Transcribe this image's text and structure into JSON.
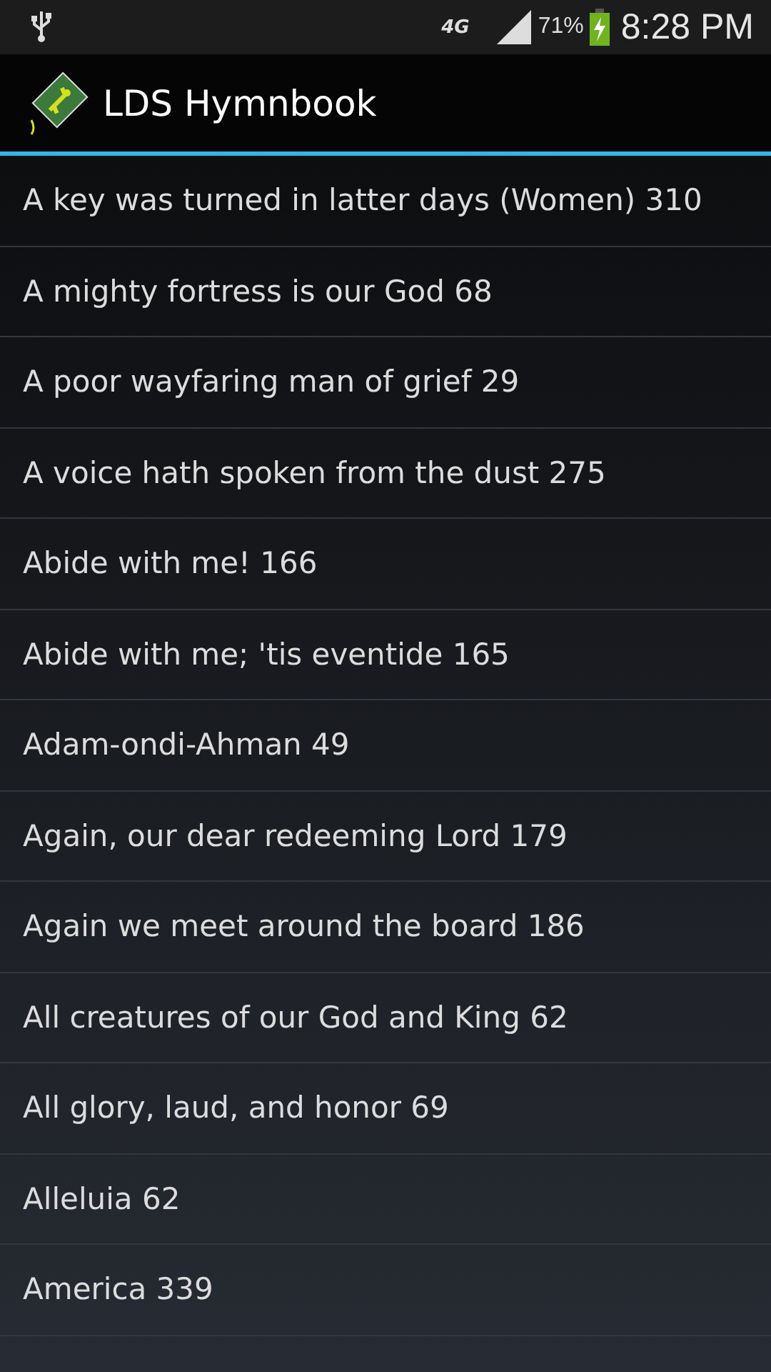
{
  "status_bar": {
    "network": "4G",
    "battery": "71%",
    "time": "8:28 PM"
  },
  "action_bar": {
    "title": "LDS Hymnbook"
  },
  "hymns": [
    {
      "title": "A key was turned in latter days (Women) 310"
    },
    {
      "title": "A mighty fortress is our God 68"
    },
    {
      "title": "A poor wayfaring man of grief 29"
    },
    {
      "title": "A voice hath spoken from the dust 275"
    },
    {
      "title": "Abide with me! 166"
    },
    {
      "title": "Abide with me; 'tis eventide 165"
    },
    {
      "title": "Adam-ondi-Ahman 49"
    },
    {
      "title": "Again, our dear redeeming Lord 179"
    },
    {
      "title": "Again we meet around the board 186"
    },
    {
      "title": "All creatures of our God and King 62"
    },
    {
      "title": "All glory, laud, and honor 69"
    },
    {
      "title": "Alleluia 62"
    },
    {
      "title": "America 339"
    }
  ]
}
